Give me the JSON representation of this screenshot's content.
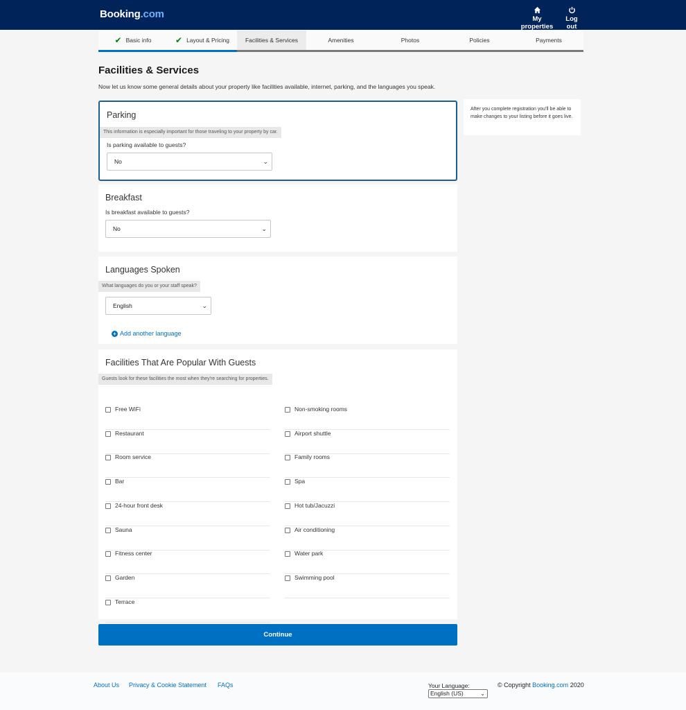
{
  "header": {
    "logo_main": "Booking",
    "logo_suffix": ".com",
    "my_properties": "My properties",
    "logout": "Log out"
  },
  "steps": [
    {
      "label": "Basic info",
      "state": "done"
    },
    {
      "label": "Layout & Pricing",
      "state": "done"
    },
    {
      "label": "Facilities & Services",
      "state": "active"
    },
    {
      "label": "Amenities",
      "state": "pending"
    },
    {
      "label": "Photos",
      "state": "pending"
    },
    {
      "label": "Policies",
      "state": "pending"
    },
    {
      "label": "Payments",
      "state": "pending"
    }
  ],
  "page": {
    "title": "Facilities & Services",
    "intro": "Now let us know some general details about your property like facilities available, internet, parking, and the languages you speak."
  },
  "parking": {
    "title": "Parking",
    "hint": "This information is especially important for those traveling to your property by car.",
    "question": "Is parking available to guests?",
    "value": "No"
  },
  "breakfast": {
    "title": "Breakfast",
    "question": "Is breakfast available to guests?",
    "value": "No"
  },
  "languages": {
    "title": "Languages Spoken",
    "hint": "What languages do you or your staff speak?",
    "value": "English",
    "add_label": "Add another language"
  },
  "facilities": {
    "title": "Facilities That Are Popular With Guests",
    "hint": "Guests look for these facilities the most when they're searching for properties.",
    "left": [
      "Free WiFi",
      "Restaurant",
      "Room service",
      "Bar",
      "24-hour front desk",
      "Sauna",
      "Fitness center",
      "Garden",
      "Terrace"
    ],
    "right": [
      "Non-smoking rooms",
      "Airport shuttle",
      "Family rooms",
      "Spa",
      "Hot tub/Jacuzzi",
      "Air conditioning",
      "Water park",
      "Swimming pool"
    ]
  },
  "continue_label": "Continue",
  "side_note": "After you complete registration you'll be able to make changes to your listing before it goes live.",
  "footer": {
    "about": "About Us",
    "privacy": "Privacy & Cookie Statement",
    "faqs": "FAQs",
    "language_label": "Your Language:",
    "language_value": "English (US)",
    "copyright_prefix": "© Copyright ",
    "copyright_brand": "Booking.com",
    "copyright_year": " 2020"
  },
  "colors": {
    "header_bg": "#002359",
    "accent": "#0071c2",
    "check": "#008009"
  }
}
